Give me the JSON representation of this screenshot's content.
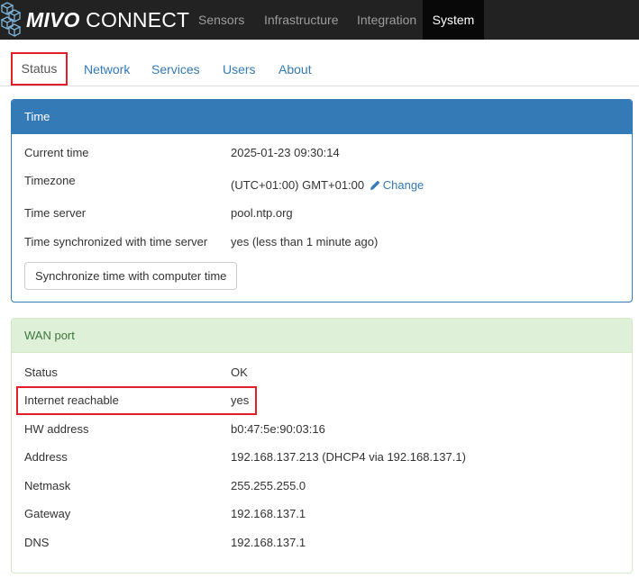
{
  "brand": {
    "bold": "MIVO",
    "light": " CONNECT",
    "logo_icon": "cube-network-icon"
  },
  "nav": {
    "items": [
      {
        "label": "Sensors"
      },
      {
        "label": "Infrastructure"
      },
      {
        "label": "Integration"
      },
      {
        "label": "System",
        "active": true
      }
    ]
  },
  "tabs": [
    {
      "label": "Status",
      "active": true
    },
    {
      "label": "Network"
    },
    {
      "label": "Services"
    },
    {
      "label": "Users"
    },
    {
      "label": "About"
    }
  ],
  "time_panel": {
    "title": "Time",
    "rows": [
      {
        "label": "Current time",
        "value": "2025-01-23 09:30:14"
      },
      {
        "label": "Timezone",
        "value": "(UTC+01:00) GMT+01:00",
        "link": "Change",
        "link_icon": "pencil-icon"
      },
      {
        "label": "Time server",
        "value": "pool.ntp.org"
      },
      {
        "label": "Time synchronized with time server",
        "value": "yes (less than 1 minute ago)"
      }
    ],
    "sync_button": "Synchronize time with computer time"
  },
  "wan_panel": {
    "title": "WAN port",
    "rows": [
      {
        "label": "Status",
        "value": "OK"
      },
      {
        "label": "Internet reachable",
        "value": "yes"
      },
      {
        "label": "HW address",
        "value": "b0:47:5e:90:03:16"
      },
      {
        "label": "Address",
        "value": "192.168.137.213 (DHCP4 via 192.168.137.1)"
      },
      {
        "label": "Netmask",
        "value": "255.255.255.0"
      },
      {
        "label": "Gateway",
        "value": "192.168.137.1"
      },
      {
        "label": "DNS",
        "value": "192.168.137.1"
      }
    ]
  },
  "colors": {
    "navbar": "#222222",
    "primary": "#337ab7",
    "success_bg": "#dff0d8",
    "success_text": "#3c763d",
    "highlight": "#e41e26"
  }
}
